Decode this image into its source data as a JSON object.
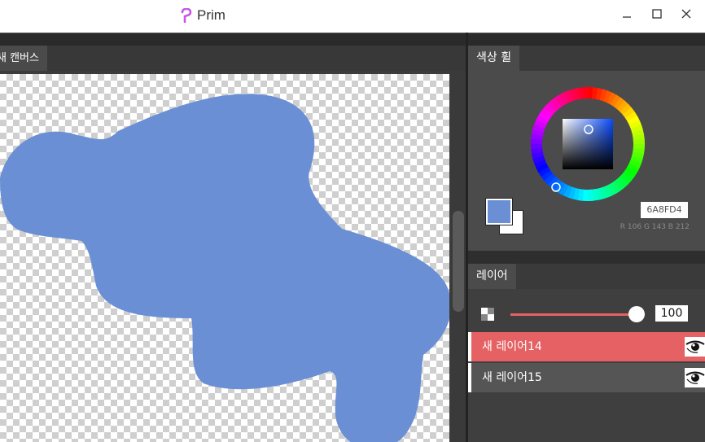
{
  "titlebar": {
    "app_name": "Prim",
    "logo_color": "#c855e8",
    "controls": {
      "minimize": "minimize-icon",
      "maximize": "maximize-icon",
      "close": "close-icon"
    }
  },
  "document": {
    "tab_label": "새 캔버스"
  },
  "canvas": {
    "stroke_color": "#6A8FD4"
  },
  "color_panel": {
    "tab_label": "색상 휠",
    "hex_value": "6A8FD4",
    "rgb_text": "R 106 G 143 B 212",
    "foreground_color": "#6A8FD4",
    "background_color": "#FFFFFF"
  },
  "layers_panel": {
    "tab_label": "레이어",
    "opacity_value": "100",
    "accent_color": "#e56163",
    "layers": [
      {
        "name": "새 레이어14",
        "selected": true,
        "visible_icon": "eye-icon"
      },
      {
        "name": "새 레이어15",
        "selected": false,
        "visible_icon": "eye-icon"
      }
    ]
  }
}
